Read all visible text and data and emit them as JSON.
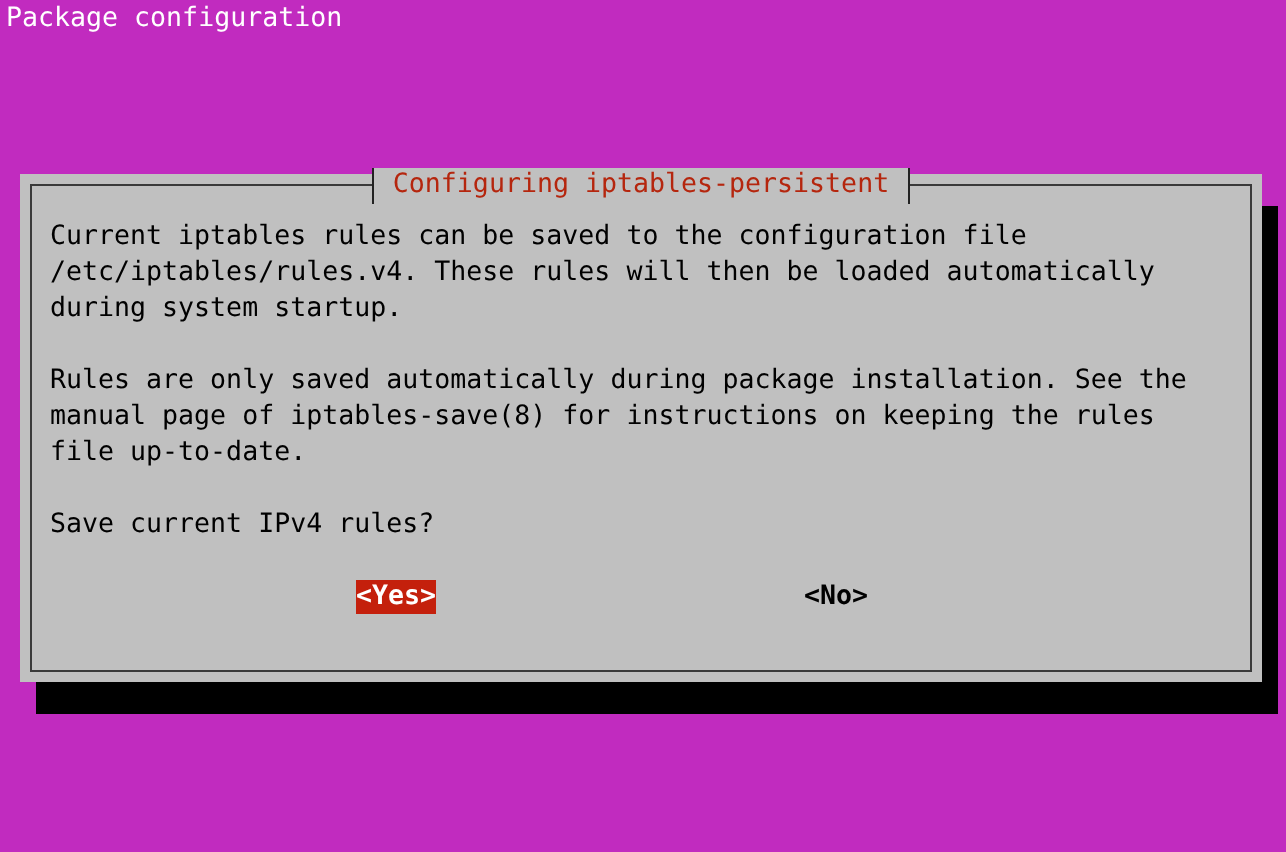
{
  "screen_title": "Package configuration",
  "dialog": {
    "title": "Configuring iptables-persistent",
    "paragraphs": [
      "Current iptables rules can be saved to the configuration file /etc/iptables/rules.v4. These rules will then be loaded automatically during system startup.",
      "Rules are only saved automatically during package installation. See the manual page of iptables-save(8) for instructions on keeping the rules file up-to-date.",
      "Save current IPv4 rules?"
    ],
    "buttons": [
      {
        "label": "<Yes>",
        "selected": true
      },
      {
        "label": "<No>",
        "selected": false
      }
    ]
  }
}
